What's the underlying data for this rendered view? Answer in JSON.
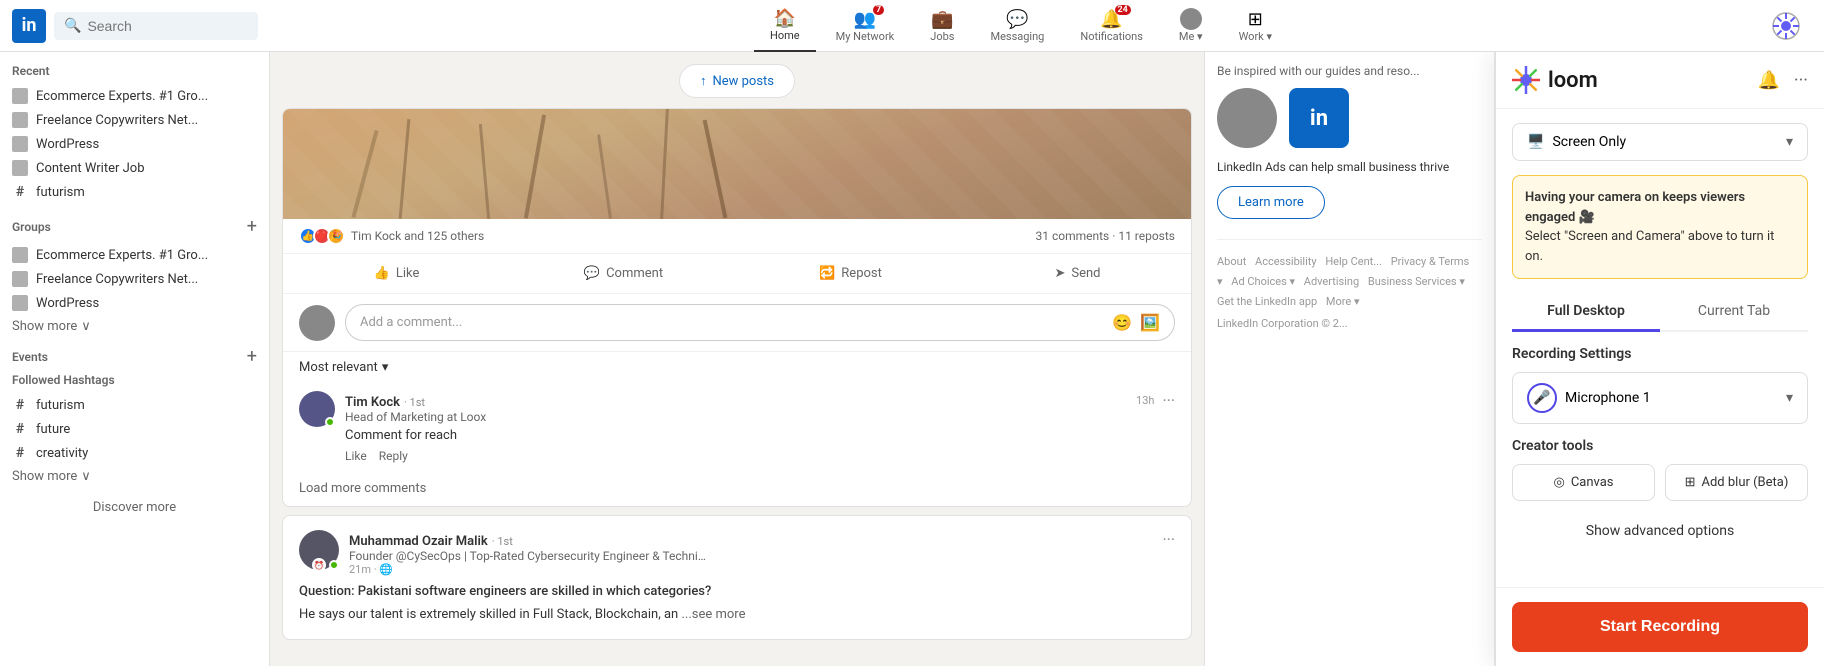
{
  "linkedin": {
    "logo": "in",
    "search_placeholder": "Search",
    "topnav": {
      "items": [
        {
          "label": "Home",
          "active": true,
          "badge": null
        },
        {
          "label": "My Network",
          "active": false,
          "badge": null
        },
        {
          "label": "Jobs",
          "active": false,
          "badge": null
        },
        {
          "label": "Messaging",
          "active": false,
          "badge": null
        },
        {
          "label": "Notifications",
          "active": false,
          "badge": "24"
        },
        {
          "label": "Me",
          "active": false,
          "badge": null
        },
        {
          "label": "Work",
          "active": false,
          "badge": null
        }
      ]
    },
    "sidebar": {
      "recent_label": "Recent",
      "recent_items": [
        "Ecommerce Experts. #1 Gro...",
        "Freelance Copywriters Net...",
        "WordPress",
        "Content Writer Job",
        "futurism"
      ],
      "groups_label": "Groups",
      "group_items": [
        "Ecommerce Experts. #1 Gro...",
        "Freelance Copywriters Net...",
        "WordPress"
      ],
      "show_more_groups": "Show more",
      "events_label": "Events",
      "hashtags_label": "Followed Hashtags",
      "hashtag_items": [
        "futurism",
        "future",
        "creativity"
      ],
      "show_more_hashtags": "Show more",
      "discover_more": "Discover more"
    },
    "feed": {
      "new_posts": "New posts",
      "reactions_count": "Tim Kock and 125 others",
      "comments_count": "31 comments · 11 reposts",
      "actions": [
        "Like",
        "Comment",
        "Repost",
        "Send"
      ],
      "comment_placeholder": "Add a comment...",
      "most_relevant": "Most relevant",
      "comments": [
        {
          "name": "Tim Kock",
          "badge": "1st",
          "title": "Head of Marketing at Loox",
          "time": "13h",
          "text": "Comment for reach",
          "actions": [
            "Like",
            "Reply"
          ]
        }
      ],
      "load_more": "Load more comments",
      "post2": {
        "name": "Muhammad Ozair Malik",
        "badge": "1st",
        "title": "Founder @CySecOps | Top-Rated Cybersecurity Engineer & Technical C...",
        "time": "21m",
        "question": "Question: Pakistani software engineers are skilled in which categories?",
        "body": "He says our talent is extremely skilled in Full Stack, Blockchain, an",
        "see_more": "...see more"
      }
    },
    "ad": {
      "text": "Be inspired with our guides and reso...",
      "desc": "LinkedIn Ads can help small business thrive",
      "learn_more": "Learn more"
    },
    "footer": {
      "links": [
        "About",
        "Accessibility",
        "Help Cent...",
        "Privacy & Terms",
        "Ad Choice...",
        "Advertising",
        "Business Services",
        "Get the LinkedIn app",
        "More"
      ],
      "copyright": "LinkedIn Corporation © 2..."
    }
  },
  "loom": {
    "logo_name": "loom",
    "header": {
      "bell_icon": "bell",
      "more_icon": "ellipsis"
    },
    "screen_select": {
      "label": "Screen Only",
      "icon": "monitor"
    },
    "warning": {
      "title": "Having your camera on keeps viewers engaged 🎥",
      "body": "Select \"Screen and Camera\" above to turn it on."
    },
    "tabs": [
      {
        "label": "Full Desktop",
        "active": true
      },
      {
        "label": "Current Tab",
        "active": false
      }
    ],
    "recording_settings_label": "Recording Settings",
    "microphone": {
      "label": "Microphone 1",
      "icon": "microphone"
    },
    "creator_tools_label": "Creator tools",
    "creator_tools": [
      {
        "label": "Canvas",
        "icon": "circle-dashed"
      },
      {
        "label": "Add blur (Beta)",
        "icon": "grid"
      }
    ],
    "advanced_options": "Show advanced options",
    "start_recording": "Start Recording"
  }
}
